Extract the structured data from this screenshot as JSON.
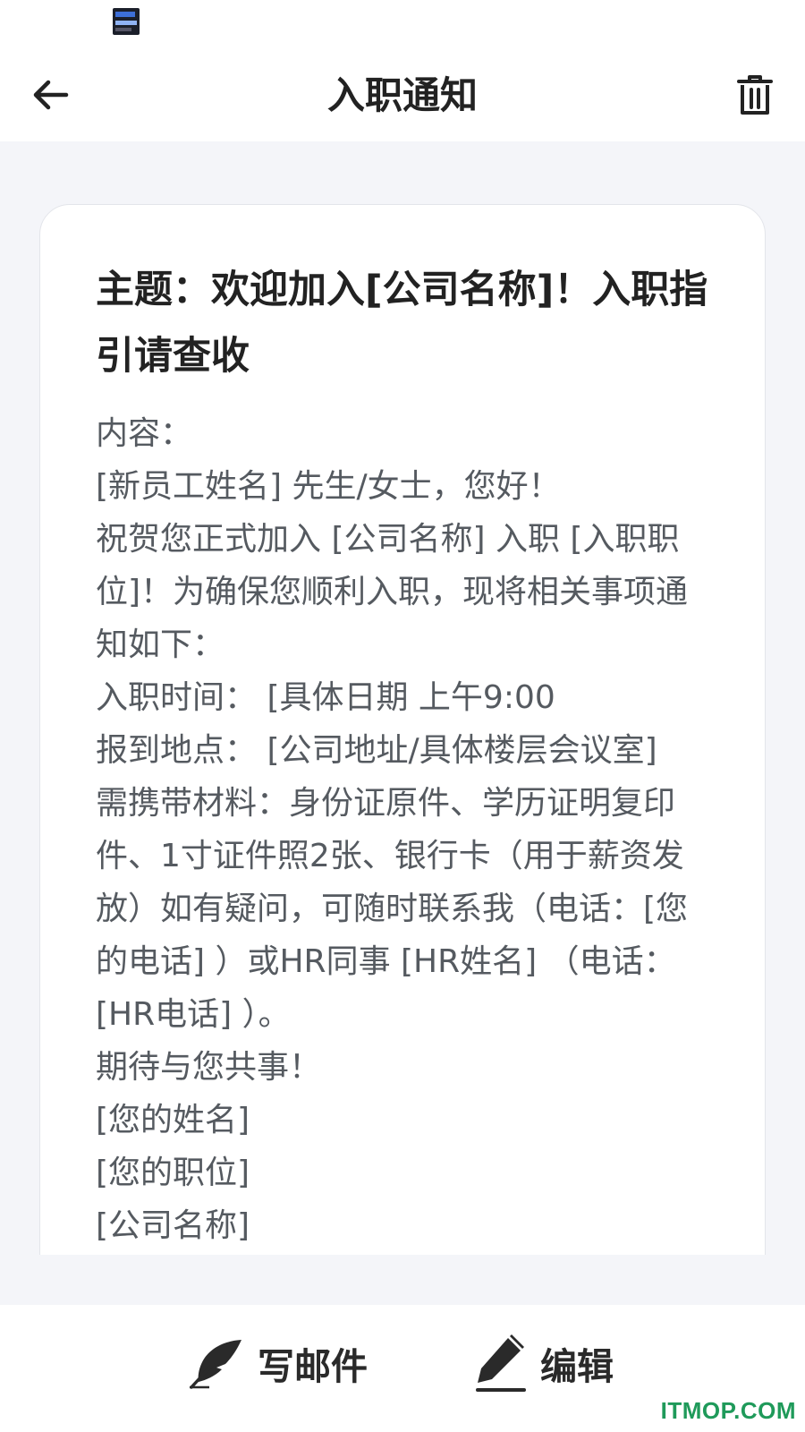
{
  "header": {
    "title": "入职通知"
  },
  "icons": {
    "back": "arrow-left-icon",
    "delete": "trash-icon",
    "compose": "feather-quill-icon",
    "edit": "pencil-icon"
  },
  "email": {
    "subject": "主题：欢迎加入[公司名称]！入职指引请查收",
    "lines": [
      "内容：",
      "[新员工姓名] 先生/女士，您好！",
      "祝贺您正式加入 [公司名称] 入职 [入职职位]！为确保您顺利入职，现将相关事项通知如下：",
      "入职时间： [具体日期 上午9:00",
      "报到地点： [公司地址/具体楼层会议室]",
      "需携带材料：身份证原件、学历证明复印件、1寸证件照2张、银行卡（用于薪资发放）如有疑问，可随时联系我（电话：[您的电话] ）或HR同事 [HR姓名] （电话： [HR电话] ）。",
      "期待与您共事！",
      "[您的姓名]",
      "[您的职位]",
      "[公司名称]"
    ]
  },
  "actions": {
    "compose_label": "写邮件",
    "edit_label": "编辑"
  },
  "watermark": "ITMOP.COM",
  "colors": {
    "background": "#f4f5f9",
    "card": "#ffffff",
    "title_text": "#222222",
    "body_text": "#555a60",
    "watermark": "#1f9a5a"
  }
}
